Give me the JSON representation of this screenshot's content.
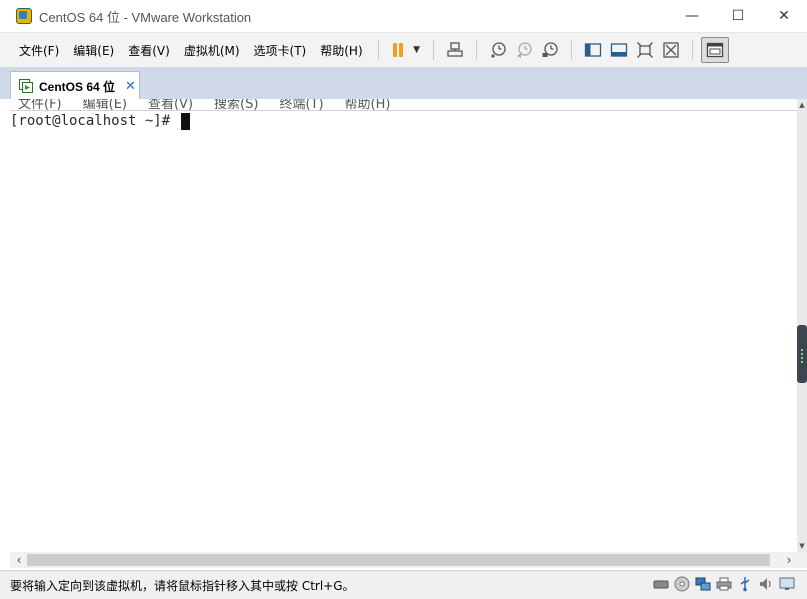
{
  "window": {
    "title": "CentOS 64 位 - VMware Workstation"
  },
  "window_controls": {
    "minimize": "—",
    "maximize": "☐",
    "close": "✕"
  },
  "menubar": {
    "items": [
      {
        "label": "文件(F)"
      },
      {
        "label": "编辑(E)"
      },
      {
        "label": "查看(V)"
      },
      {
        "label": "虚拟机(M)"
      },
      {
        "label": "选项卡(T)"
      },
      {
        "label": "帮助(H)"
      }
    ]
  },
  "toolbar": {
    "buttons": [
      "pause-icon",
      "power-dropdown-icon",
      "send-ctrl-alt-del-icon",
      "snapshot-take-icon",
      "snapshot-revert-icon",
      "snapshot-manager-icon",
      "show-library-icon",
      "thumbnail-bar-icon",
      "fullscreen-icon",
      "unity-icon",
      "console-view-icon"
    ],
    "dropdown_glyph": "▼"
  },
  "tabs": [
    {
      "label": "CentOS 64 位",
      "close": "✕"
    }
  ],
  "guest": {
    "menu": [
      "文件(F)",
      "编辑(E)",
      "查看(V)",
      "搜索(S)",
      "终端(T)",
      "帮助(H)"
    ],
    "prompt": "[root@localhost ~]# "
  },
  "statusbar": {
    "message": "要将输入定向到该虚拟机，请将鼠标指针移入其中或按 Ctrl+G。",
    "icons": [
      "hard-disk-icon",
      "cd-dvd-icon",
      "network-icon",
      "printer-icon",
      "usb-icon",
      "sound-icon",
      "display-icon"
    ]
  },
  "colors": {
    "tabstrip": "#cfd9e8",
    "accent": "#2d6fb0",
    "pause": "#f0a020"
  }
}
